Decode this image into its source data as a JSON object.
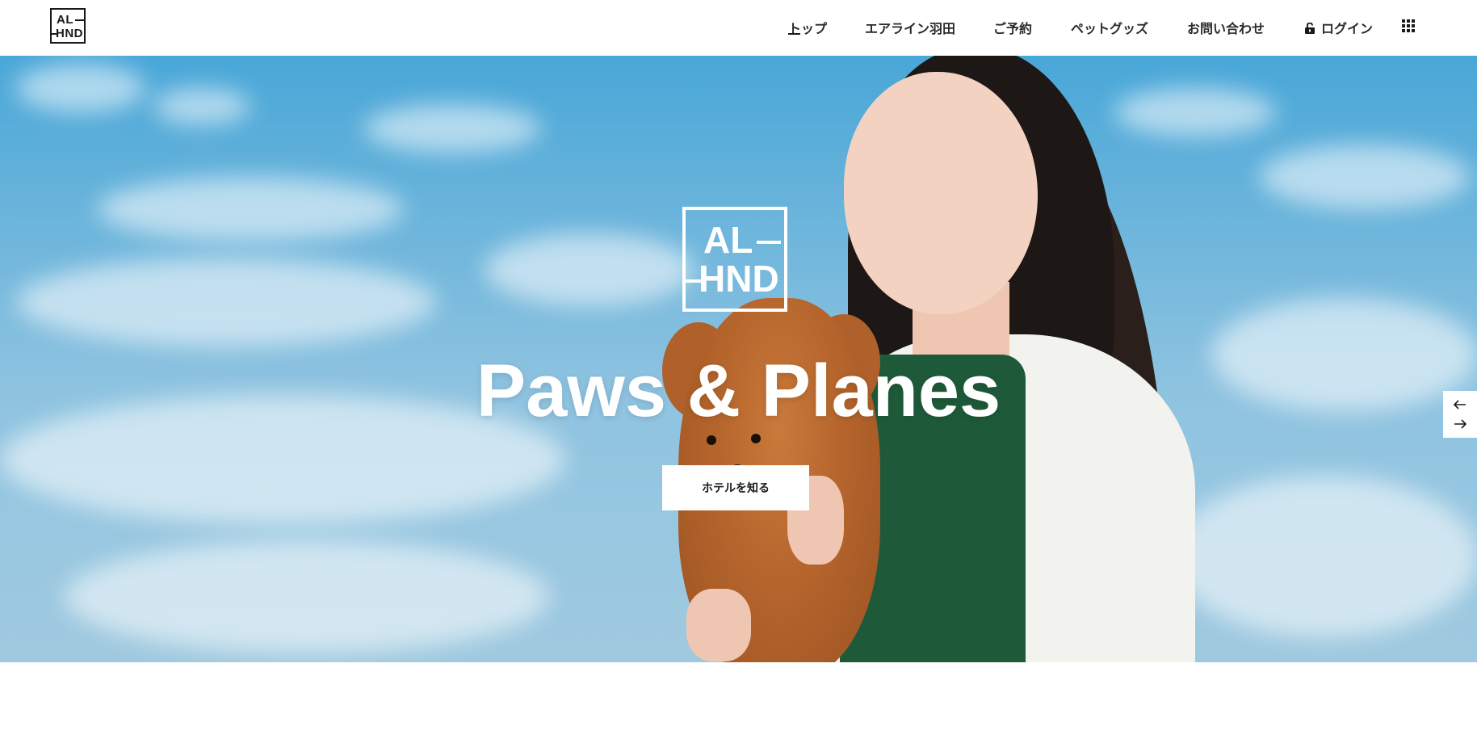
{
  "header": {
    "logo": {
      "line1": "AL",
      "line2": "HND"
    },
    "nav": [
      {
        "label": "トップ",
        "active": true
      },
      {
        "label": "エアライン羽田"
      },
      {
        "label": "ご予約"
      },
      {
        "label": "ペットグッズ"
      },
      {
        "label": "お問い合わせ"
      },
      {
        "label": "ログイン",
        "icon": "lock-open-icon"
      }
    ],
    "menu_icon": "grid-menu-icon"
  },
  "hero": {
    "logo": {
      "line1": "AL",
      "line2": "HND"
    },
    "title": "Paws & Planes",
    "button_label": "ホテルを知る",
    "prev_icon": "arrow-left-icon",
    "next_icon": "arrow-right-icon"
  },
  "colors": {
    "sky": "#49a7d8",
    "text": "#1a1a1a",
    "button_bg": "#ffffff",
    "apron": "#1e5a3a"
  }
}
